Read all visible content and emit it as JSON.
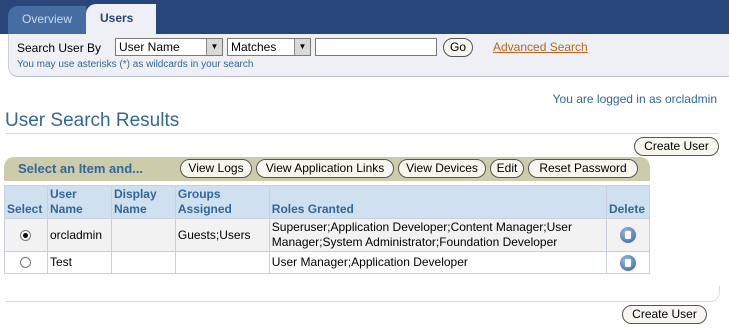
{
  "tabs": [
    {
      "label": "Overview"
    },
    {
      "label": "Users"
    }
  ],
  "search": {
    "label": "Search User By",
    "field_value": "User Name",
    "operator_value": "Matches",
    "input_value": "",
    "go_label": "Go",
    "advanced_label": "Advanced Search",
    "hint": "You may use asterisks (*) as wildcards in your search"
  },
  "session": {
    "logged_in_text": "You are logged in as orcladmin"
  },
  "page": {
    "title": "User Search Results",
    "create_user_label": "Create User"
  },
  "actions": {
    "label": "Select an Item and...",
    "buttons": [
      "View Logs",
      "View Application Links",
      "View Devices",
      "Edit",
      "Reset Password"
    ]
  },
  "table": {
    "headers": [
      "Select",
      "User Name",
      "Display Name",
      "Groups Assigned",
      "Roles Granted",
      "Delete"
    ],
    "rows": [
      {
        "selected": true,
        "user_name": "orcladmin",
        "display_name": "",
        "groups": "Guests;Users",
        "roles": "Superuser;Application Developer;Content Manager;User Manager;System Administrator;Foundation Developer"
      },
      {
        "selected": false,
        "user_name": "Test",
        "display_name": "",
        "groups": "",
        "roles": "User Manager;Application Developer"
      }
    ]
  },
  "colors": {
    "header_bg": "#29467b",
    "accent": "#336699",
    "link": "#b6671b",
    "action_bar": "#ccccaa"
  }
}
